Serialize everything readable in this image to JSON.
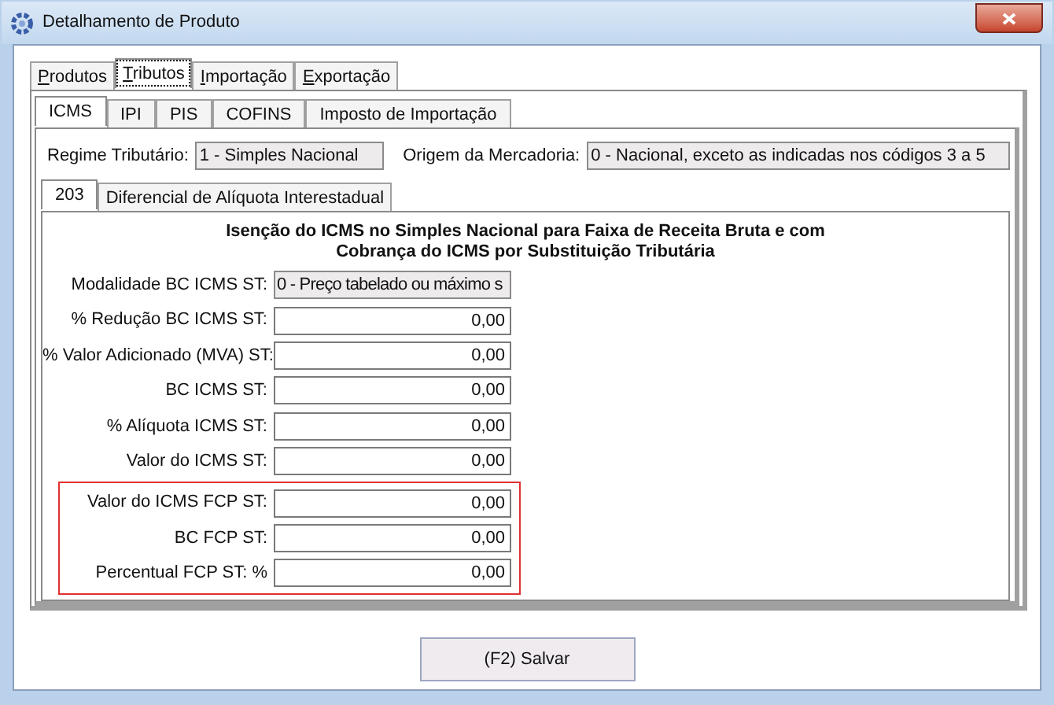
{
  "window": {
    "title": "Detalhamento de Produto"
  },
  "tabs": [
    {
      "label": "Produtos",
      "selected": false
    },
    {
      "label": "Tributos",
      "selected": true
    },
    {
      "label": "Importação",
      "selected": false
    },
    {
      "label": "Exportação",
      "selected": false
    }
  ],
  "tax_tabs": [
    {
      "label": "ICMS",
      "selected": true
    },
    {
      "label": "IPI",
      "selected": false
    },
    {
      "label": "PIS",
      "selected": false
    },
    {
      "label": "COFINS",
      "selected": false
    },
    {
      "label": "Imposto de Importação",
      "selected": false
    }
  ],
  "regime": {
    "label": "Regime Tributário:",
    "value": "1 - Simples Nacional"
  },
  "origem": {
    "label": "Origem da Mercadoria:",
    "value": "0 - Nacional, exceto as indicadas nos códigos 3 a 5"
  },
  "sub_tabs": [
    {
      "label": "203",
      "selected": true
    },
    {
      "label": "Diferencial de Alíquota Interestadual",
      "selected": false
    }
  ],
  "heading": "Isenção do ICMS no Simples Nacional para Faixa de Receita Bruta e com Cobrança do ICMS por Substituição Tributária",
  "fields": [
    {
      "label": "Modalidade BC ICMS ST:",
      "value": "0 - Preço tabelado ou máximo s",
      "kind": "select"
    },
    {
      "label": "% Redução BC ICMS ST:",
      "value": "0,00",
      "kind": "number"
    },
    {
      "label": "% Valor Adicionado (MVA) ST:",
      "value": "0,00",
      "kind": "number"
    },
    {
      "label": "BC ICMS ST:",
      "value": "0,00",
      "kind": "number"
    },
    {
      "label": "% Alíquota ICMS ST:",
      "value": "0,00",
      "kind": "number"
    },
    {
      "label": "Valor do ICMS ST:",
      "value": "0,00",
      "kind": "number"
    }
  ],
  "highlighted_fields": [
    {
      "label": "Valor do ICMS FCP ST:",
      "value": "0,00",
      "kind": "number"
    },
    {
      "label": "BC FCP ST:",
      "value": "0,00",
      "kind": "number"
    },
    {
      "label": "Percentual FCP ST: %",
      "value": "0,00",
      "kind": "number"
    }
  ],
  "save_button": "(F2) Salvar"
}
